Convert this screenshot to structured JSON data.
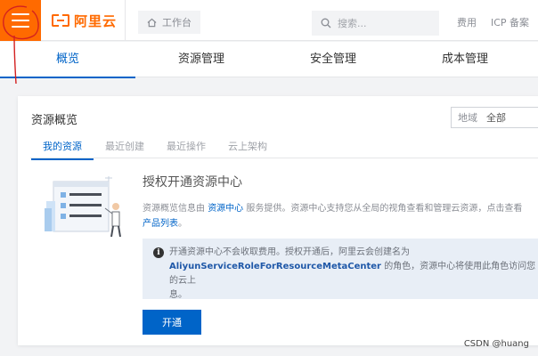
{
  "topbar": {
    "logo_text": "阿里云",
    "workbench_label": "工作台",
    "search_placeholder": "搜索...",
    "links": [
      "费用",
      "ICP 备案"
    ]
  },
  "main_tabs": [
    "概览",
    "资源管理",
    "安全管理",
    "成本管理"
  ],
  "card": {
    "title": "资源概览",
    "region": {
      "label": "地域",
      "value": "全部"
    },
    "subtabs": [
      "我的资源",
      "最近创建",
      "最近操作",
      "云上架构"
    ],
    "panel_title": "授权开通资源中心",
    "desc_prefix": "资源概览信息由",
    "desc_link": "资源中心",
    "desc_middle": "服务提供。资源中心支持您从全局的视角查看和管理云资源，点击查看",
    "desc_link2": "产品列表",
    "desc_suffix": "。",
    "info_line1": "开通资源中心不会收取费用。授权开通后，阿里云会创建名为",
    "info_role": "AliyunServiceRoleForResourceMetaCenter",
    "info_line2": "的角色，资源中心将使用此角色访问您的云上",
    "info_line3": "息。",
    "activate_label": "开通"
  },
  "watermark": "CSDN @huang",
  "colors": {
    "brand": "#ff6a00",
    "primary": "#0064c8",
    "info_bg": "#e8eef6"
  }
}
